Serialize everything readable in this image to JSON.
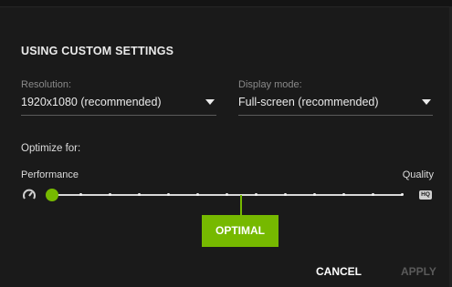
{
  "header": {
    "title": "USING CUSTOM SETTINGS"
  },
  "resolution": {
    "label": "Resolution:",
    "value": "1920x1080 (recommended)"
  },
  "display_mode": {
    "label": "Display mode:",
    "value": "Full-screen (recommended)"
  },
  "optimize": {
    "label": "Optimize for:",
    "left_label": "Performance",
    "right_label": "Quality",
    "left_icon": "speedometer-icon",
    "right_icon": "hq-icon",
    "right_icon_text": "HQ",
    "position_fraction": 0.0,
    "optimal_fraction": 0.54
  },
  "buttons": {
    "optimal_label": "OPTIMAL",
    "cancel_label": "CANCEL",
    "apply_label": "APPLY"
  },
  "colors": {
    "accent": "#76b900",
    "background": "#1a1a1a",
    "disabled_text": "#5a5a5a"
  }
}
